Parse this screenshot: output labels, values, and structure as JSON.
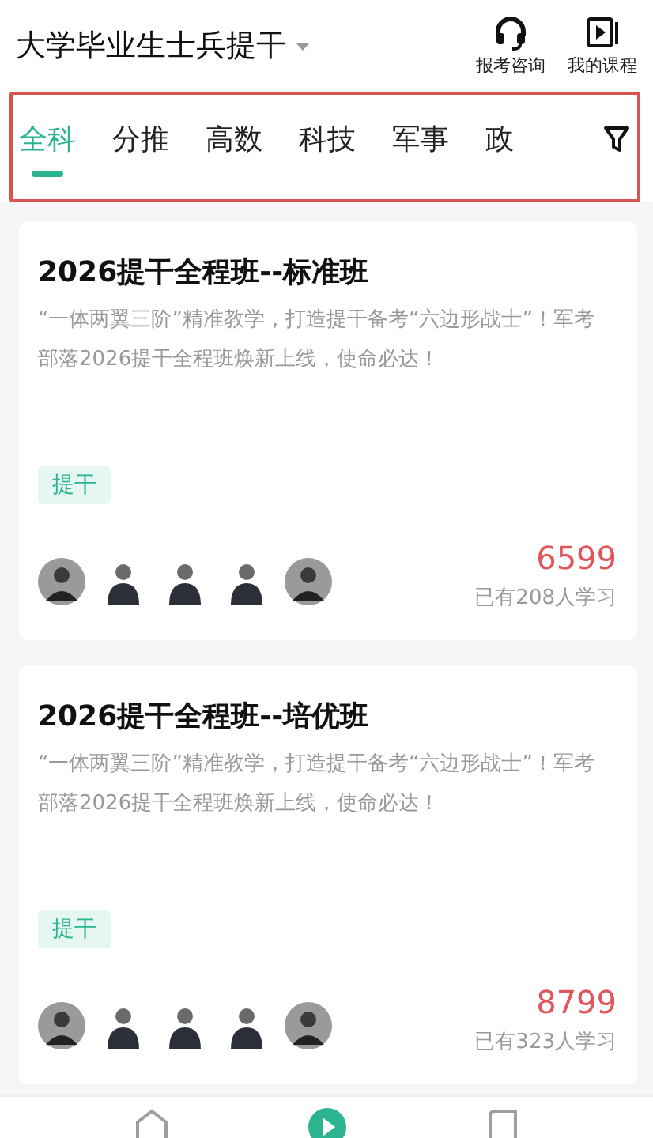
{
  "header": {
    "title": "大学毕业生士兵提干",
    "actions": [
      {
        "kind": "headset",
        "label": "报考咨询"
      },
      {
        "kind": "play",
        "label": "我的课程"
      }
    ]
  },
  "tabs": [
    {
      "label": "全科",
      "selected": true
    },
    {
      "label": "分推",
      "selected": false
    },
    {
      "label": "高数",
      "selected": false
    },
    {
      "label": "科技",
      "selected": false
    },
    {
      "label": "军事",
      "selected": false
    },
    {
      "label": "政",
      "selected": false
    }
  ],
  "courses": [
    {
      "title": "2026提干全程班--标准班",
      "description": "“一体两翼三阶”精准教学，打造提干备考“六边形战士”！军考部落2026提干全程班焕新上线，使命必达！",
      "tag": "提干",
      "teachers": [
        {
          "kind": "round"
        },
        {
          "kind": "cutout"
        },
        {
          "kind": "cutout"
        },
        {
          "kind": "cutout"
        },
        {
          "kind": "round"
        }
      ],
      "price": "6599",
      "learners": "已有208人学习"
    },
    {
      "title": "2026提干全程班--培优班",
      "description": "“一体两翼三阶”精准教学，打造提干备考“六边形战士”！军考部落2026提干全程班焕新上线，使命必达！",
      "tag": "提干",
      "teachers": [
        {
          "kind": "round"
        },
        {
          "kind": "cutout"
        },
        {
          "kind": "cutout"
        },
        {
          "kind": "cutout"
        },
        {
          "kind": "round"
        }
      ],
      "price": "8799",
      "learners": "已有323人学习"
    }
  ],
  "bottom_nav": [
    {
      "kind": "home",
      "selected": false
    },
    {
      "kind": "play",
      "selected": true
    },
    {
      "kind": "book",
      "selected": false
    }
  ]
}
